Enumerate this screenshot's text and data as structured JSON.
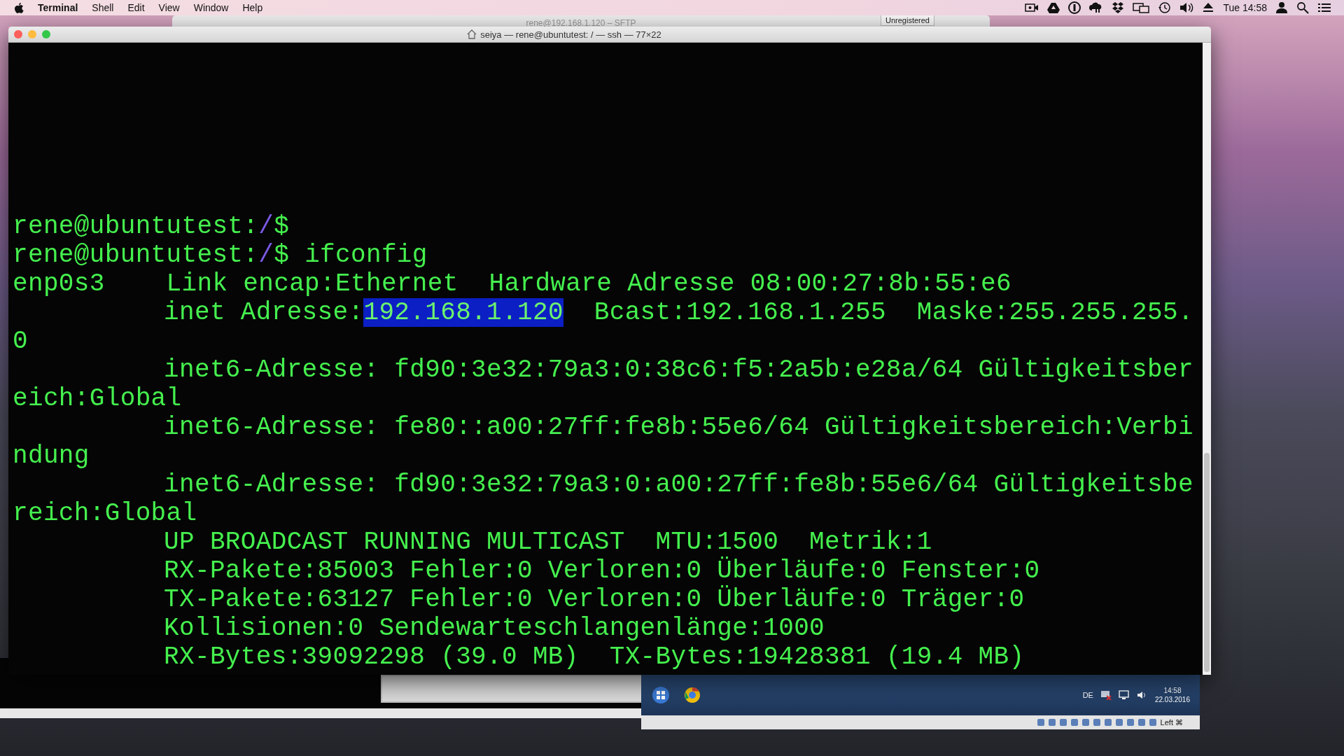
{
  "menu_bar": {
    "app_name": "Terminal",
    "menus": [
      "Shell",
      "Edit",
      "View",
      "Window",
      "Help"
    ],
    "clock": "Tue 14:58"
  },
  "background_window": {
    "title": "rene@192.168.1.120 – SFTP",
    "badge": "Unregistered"
  },
  "terminal": {
    "title": "seiya — rene@ubuntutest: / — ssh — 77×22",
    "lines": [
      {
        "indented": false,
        "segments": [
          {
            "kind": "text",
            "text": "rene@ubuntutest:"
          },
          {
            "kind": "path",
            "text": "/"
          },
          {
            "kind": "text",
            "text": "$"
          }
        ]
      },
      {
        "indented": false,
        "segments": [
          {
            "kind": "text",
            "text": "rene@ubuntutest:"
          },
          {
            "kind": "path",
            "text": "/"
          },
          {
            "kind": "text",
            "text": "$ ifconfig"
          }
        ]
      },
      {
        "indented": false,
        "segments": [
          {
            "kind": "text",
            "text": "enp0s3    Link encap:Ethernet  Hardware Adresse 08:00:27:8b:55:e6"
          }
        ]
      },
      {
        "indented": true,
        "segments": [
          {
            "kind": "text",
            "text": "inet Adresse:"
          },
          {
            "kind": "selection",
            "text": "192.168.1.120"
          },
          {
            "kind": "text",
            "text": "  Bcast:192.168.1.255  Maske:255.255.255."
          }
        ]
      },
      {
        "indented": false,
        "segments": [
          {
            "kind": "text",
            "text": "0"
          }
        ]
      },
      {
        "indented": true,
        "segments": [
          {
            "kind": "text",
            "text": "inet6-Adresse: fd90:3e32:79a3:0:38c6:f5:2a5b:e28a/64 Gültigkeitsber"
          }
        ]
      },
      {
        "indented": false,
        "segments": [
          {
            "kind": "text",
            "text": "eich:Global"
          }
        ]
      },
      {
        "indented": true,
        "segments": [
          {
            "kind": "text",
            "text": "inet6-Adresse: fe80::a00:27ff:fe8b:55e6/64 Gültigkeitsbereich:Verbi"
          }
        ]
      },
      {
        "indented": false,
        "segments": [
          {
            "kind": "text",
            "text": "ndung"
          }
        ]
      },
      {
        "indented": true,
        "segments": [
          {
            "kind": "text",
            "text": "inet6-Adresse: fd90:3e32:79a3:0:a00:27ff:fe8b:55e6/64 Gültigkeitsbe"
          }
        ]
      },
      {
        "indented": false,
        "segments": [
          {
            "kind": "text",
            "text": "reich:Global"
          }
        ]
      },
      {
        "indented": true,
        "segments": [
          {
            "kind": "text",
            "text": "UP BROADCAST RUNNING MULTICAST  MTU:1500  Metrik:1"
          }
        ]
      },
      {
        "indented": true,
        "segments": [
          {
            "kind": "text",
            "text": "RX-Pakete:85003 Fehler:0 Verloren:0 Überläufe:0 Fenster:0"
          }
        ]
      },
      {
        "indented": true,
        "segments": [
          {
            "kind": "text",
            "text": "TX-Pakete:63127 Fehler:0 Verloren:0 Überläufe:0 Träger:0"
          }
        ]
      },
      {
        "indented": true,
        "segments": [
          {
            "kind": "text",
            "text": "Kollisionen:0 Sendewarteschlangenlänge:1000"
          }
        ]
      },
      {
        "indented": true,
        "segments": [
          {
            "kind": "text",
            "text": "RX-Bytes:39092298 (39.0 MB)  TX-Bytes:19428381 (19.4 MB)"
          }
        ]
      }
    ]
  },
  "vm_window": {
    "language": "DE",
    "time": "14:58",
    "date": "22.03.2016",
    "host_key": "Left ⌘"
  }
}
